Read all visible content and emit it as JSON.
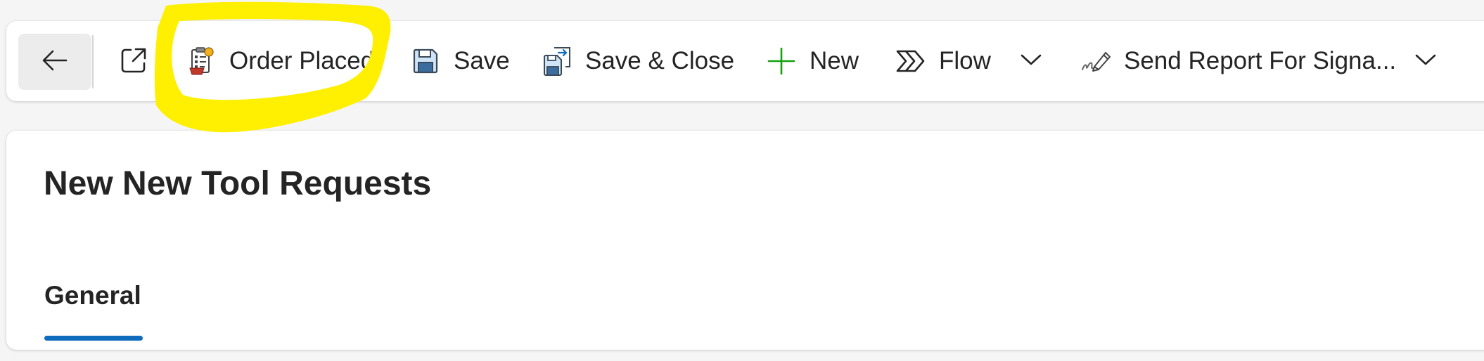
{
  "command_bar": {
    "back_icon": "arrow-left-icon",
    "popout_icon": "open-in-new-window-icon",
    "commands": {
      "order_placed": {
        "label": "Order Placed",
        "icon": "clipboard-checklist-icon"
      },
      "save": {
        "label": "Save",
        "icon": "floppy-disk-icon"
      },
      "save_close": {
        "label": "Save & Close",
        "icon": "save-and-close-icon"
      },
      "new": {
        "label": "New",
        "icon": "plus-icon"
      },
      "flow": {
        "label": "Flow",
        "icon": "power-automate-flow-icon"
      },
      "send_report": {
        "label": "Send Report For Signa...",
        "icon": "signature-pen-icon"
      }
    }
  },
  "form": {
    "title": "New New Tool Requests",
    "tabs": [
      {
        "label": "General",
        "active": true
      }
    ]
  },
  "colors": {
    "accent": "#0f6cbd",
    "new_icon": "#13a10e",
    "highlighter": "#ffef00"
  }
}
